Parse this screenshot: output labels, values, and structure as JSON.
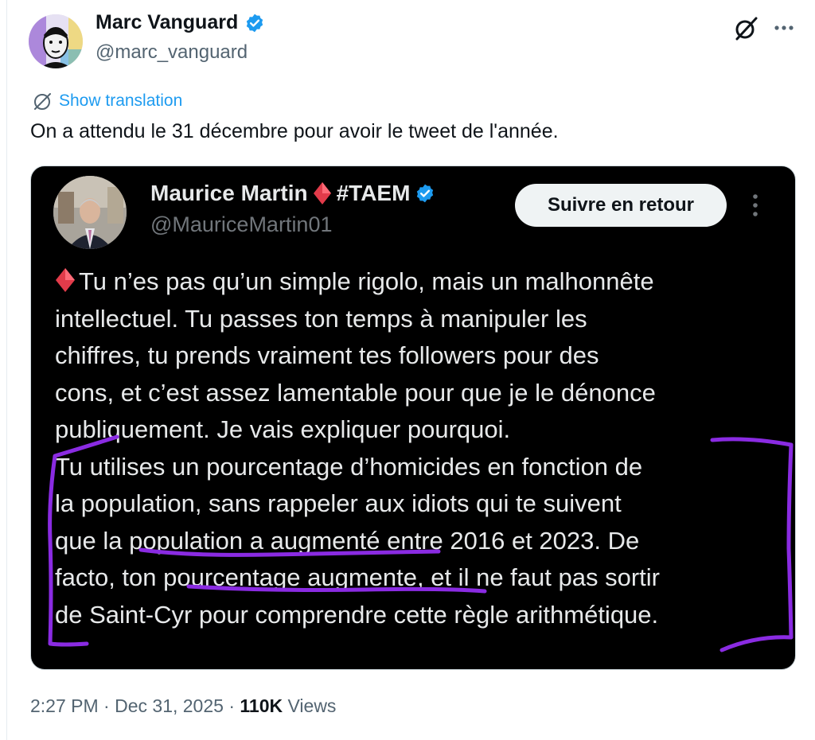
{
  "author": {
    "name": "Marc Vanguard",
    "handle": "@marc_vanguard",
    "verified": true
  },
  "translate_label": "Show translation",
  "tweet_text": "On a attendu le 31 décembre pour avoir le tweet de l'année.",
  "quoted": {
    "name": "Maurice Martin",
    "name_suffix": "#TAEM",
    "handle": "@MauriceMartin01",
    "follow_label": "Suivre en retour",
    "lines": [
      "Tu n’es pas qu’un simple rigolo, mais un malhonnête",
      "intellectuel. Tu passes ton temps à manipuler les",
      "chiffres, tu prends vraiment tes followers pour des",
      "cons, et c’est assez lamentable pour que je le dénonce",
      "publiquement. Je vais expliquer pourquoi.",
      "Tu utilises un pourcentage d’homicides en fonction de",
      "la population, sans rappeler aux idiots qui te suivent",
      "que la population a augmenté entre 2016 et 2023. De",
      "facto, ton pourcentage augmente, et il ne faut pas sortir",
      "de Saint-Cyr pour comprendre cette règle arithmétique."
    ]
  },
  "footer": {
    "time": "2:27 PM",
    "date": "Dec 31, 2025",
    "views_count": "110K",
    "views_label": "Views"
  },
  "colors": {
    "link_blue": "#1d9bf0",
    "annotation_purple": "#8a2be2",
    "diamond_red": "#e23b4a"
  },
  "icons": [
    "verified-badge-icon",
    "grok-icon",
    "more-icon",
    "translate-globe-icon",
    "red-diamond-icon",
    "kebab-icon"
  ]
}
